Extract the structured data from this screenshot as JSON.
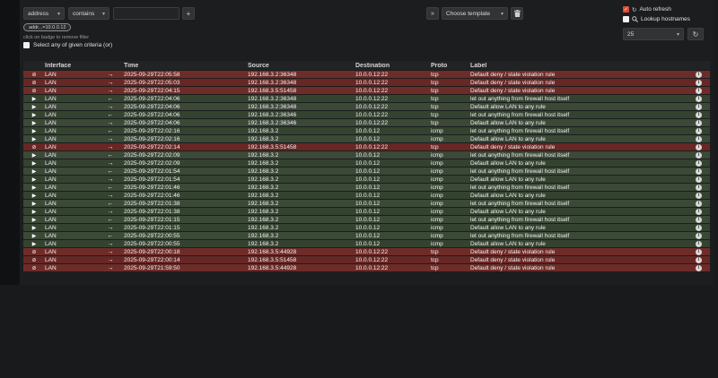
{
  "filter_bar": {
    "field_select": "address",
    "operator_select": "contains",
    "value_text": "",
    "add_button": "+",
    "expand_button": "»",
    "template_select": "Choose template",
    "auto_refresh_label": "Auto refresh",
    "lookup_hostnames_label": "Lookup hostnames",
    "page_size": "25"
  },
  "filter_tags": {
    "badge": "addr...=10.0.0.12",
    "hint": "click on badge to remove filter",
    "match_any_label": "Select any of given criteria (or)"
  },
  "colors": {
    "accent": "#dd4b39",
    "block_row": "#6e2c29",
    "pass_row": "#3b4937"
  },
  "table": {
    "columns": {
      "interface": "Interface",
      "time": "Time",
      "source": "Source",
      "destination": "Destination",
      "proto": "Proto",
      "label": "Label"
    },
    "rows": [
      {
        "action": "block",
        "interface": "LAN",
        "dir": "out",
        "time": "2025-09-29T22:05:58",
        "source": "192.168.3.2:36348",
        "destination": "10.0.0.12:22",
        "proto": "tcp",
        "label": "Default deny / state violation rule"
      },
      {
        "action": "block",
        "interface": "LAN",
        "dir": "out",
        "time": "2025-09-29T22:05:03",
        "source": "192.168.3.2:36348",
        "destination": "10.0.0.12:22",
        "proto": "tcp",
        "label": "Default deny / state violation rule"
      },
      {
        "action": "block",
        "interface": "LAN",
        "dir": "out",
        "time": "2025-09-29T22:04:15",
        "source": "192.168.3.5:51458",
        "destination": "10.0.0.12:22",
        "proto": "tcp",
        "label": "Default deny / state violation rule"
      },
      {
        "action": "pass",
        "interface": "LAN",
        "dir": "in",
        "time": "2025-09-29T22:04:06",
        "source": "192.168.3.2:36348",
        "destination": "10.0.0.12:22",
        "proto": "tcp",
        "label": "let out anything from firewall host itself"
      },
      {
        "action": "pass",
        "interface": "LAN",
        "dir": "out",
        "time": "2025-09-29T22:04:06",
        "source": "192.168.3.2:36348",
        "destination": "10.0.0.12:22",
        "proto": "tcp",
        "label": "Default allow LAN to any rule"
      },
      {
        "action": "pass",
        "interface": "LAN",
        "dir": "in",
        "time": "2025-09-29T22:04:06",
        "source": "192.168.3.2:36346",
        "destination": "10.0.0.12:22",
        "proto": "tcp",
        "label": "let out anything from firewall host itself"
      },
      {
        "action": "pass",
        "interface": "LAN",
        "dir": "out",
        "time": "2025-09-29T22:04:06",
        "source": "192.168.3.2:36346",
        "destination": "10.0.0.12:22",
        "proto": "tcp",
        "label": "Default allow LAN to any rule"
      },
      {
        "action": "pass",
        "interface": "LAN",
        "dir": "in",
        "time": "2025-09-29T22:02:16",
        "source": "192.168.3.2",
        "destination": "10.0.0.12",
        "proto": "icmp",
        "label": "let out anything from firewall host itself"
      },
      {
        "action": "pass",
        "interface": "LAN",
        "dir": "out",
        "time": "2025-09-29T22:02:16",
        "source": "192.168.3.2",
        "destination": "10.0.0.12",
        "proto": "icmp",
        "label": "Default allow LAN to any rule"
      },
      {
        "action": "block",
        "interface": "LAN",
        "dir": "out",
        "time": "2025-09-29T22:02:14",
        "source": "192.168.3.5:51458",
        "destination": "10.0.0.12:22",
        "proto": "tcp",
        "label": "Default deny / state violation rule"
      },
      {
        "action": "pass",
        "interface": "LAN",
        "dir": "in",
        "time": "2025-09-29T22:02:09",
        "source": "192.168.3.2",
        "destination": "10.0.0.12",
        "proto": "icmp",
        "label": "let out anything from firewall host itself"
      },
      {
        "action": "pass",
        "interface": "LAN",
        "dir": "out",
        "time": "2025-09-29T22:02:09",
        "source": "192.168.3.2",
        "destination": "10.0.0.12",
        "proto": "icmp",
        "label": "Default allow LAN to any rule"
      },
      {
        "action": "pass",
        "interface": "LAN",
        "dir": "in",
        "time": "2025-09-29T22:01:54",
        "source": "192.168.3.2",
        "destination": "10.0.0.12",
        "proto": "icmp",
        "label": "let out anything from firewall host itself"
      },
      {
        "action": "pass",
        "interface": "LAN",
        "dir": "out",
        "time": "2025-09-29T22:01:54",
        "source": "192.168.3.2",
        "destination": "10.0.0.12",
        "proto": "icmp",
        "label": "Default allow LAN to any rule"
      },
      {
        "action": "pass",
        "interface": "LAN",
        "dir": "in",
        "time": "2025-09-29T22:01:46",
        "source": "192.168.3.2",
        "destination": "10.0.0.12",
        "proto": "icmp",
        "label": "let out anything from firewall host itself"
      },
      {
        "action": "pass",
        "interface": "LAN",
        "dir": "out",
        "time": "2025-09-29T22:01:46",
        "source": "192.168.3.2",
        "destination": "10.0.0.12",
        "proto": "icmp",
        "label": "Default allow LAN to any rule"
      },
      {
        "action": "pass",
        "interface": "LAN",
        "dir": "in",
        "time": "2025-09-29T22:01:38",
        "source": "192.168.3.2",
        "destination": "10.0.0.12",
        "proto": "icmp",
        "label": "let out anything from firewall host itself"
      },
      {
        "action": "pass",
        "interface": "LAN",
        "dir": "out",
        "time": "2025-09-29T22:01:38",
        "source": "192.168.3.2",
        "destination": "10.0.0.12",
        "proto": "icmp",
        "label": "Default allow LAN to any rule"
      },
      {
        "action": "pass",
        "interface": "LAN",
        "dir": "in",
        "time": "2025-09-29T22:01:15",
        "source": "192.168.3.2",
        "destination": "10.0.0.12",
        "proto": "icmp",
        "label": "let out anything from firewall host itself"
      },
      {
        "action": "pass",
        "interface": "LAN",
        "dir": "out",
        "time": "2025-09-29T22:01:15",
        "source": "192.168.3.2",
        "destination": "10.0.0.12",
        "proto": "icmp",
        "label": "Default allow LAN to any rule"
      },
      {
        "action": "pass",
        "interface": "LAN",
        "dir": "in",
        "time": "2025-09-29T22:00:55",
        "source": "192.168.3.2",
        "destination": "10.0.0.12",
        "proto": "icmp",
        "label": "let out anything from firewall host itself"
      },
      {
        "action": "pass",
        "interface": "LAN",
        "dir": "out",
        "time": "2025-09-29T22:00:55",
        "source": "192.168.3.2",
        "destination": "10.0.0.12",
        "proto": "icmp",
        "label": "Default allow LAN to any rule"
      },
      {
        "action": "block",
        "interface": "LAN",
        "dir": "out",
        "time": "2025-09-29T22:00:18",
        "source": "192.168.3.5:44928",
        "destination": "10.0.0.12:22",
        "proto": "tcp",
        "label": "Default deny / state violation rule"
      },
      {
        "action": "block",
        "interface": "LAN",
        "dir": "out",
        "time": "2025-09-29T22:00:14",
        "source": "192.168.3.5:51458",
        "destination": "10.0.0.12:22",
        "proto": "tcp",
        "label": "Default deny / state violation rule"
      },
      {
        "action": "block",
        "interface": "LAN",
        "dir": "out",
        "time": "2025-09-29T21:59:50",
        "source": "192.168.3.5:44928",
        "destination": "10.0.0.12:22",
        "proto": "tcp",
        "label": "Default deny / state violation rule"
      }
    ]
  }
}
